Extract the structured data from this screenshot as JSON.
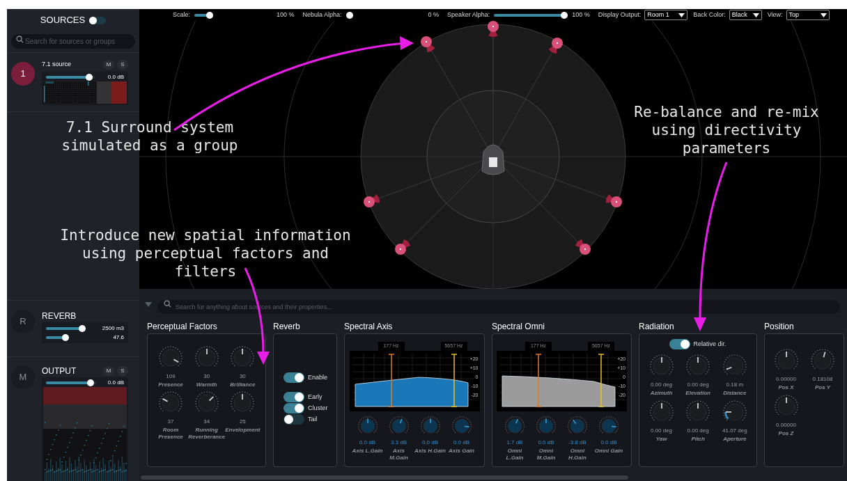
{
  "sidebar": {
    "title": "SOURCES",
    "toggle_on": false,
    "search": {
      "placeholder": "Search for sources or groups"
    },
    "sources": [
      {
        "badge": "1",
        "name": "7.1 source",
        "mute": "M",
        "solo": "S",
        "level": 0.95,
        "reading": "0.0 dB"
      }
    ],
    "reverb": {
      "badge": "R",
      "title": "REVERB",
      "sliders": [
        {
          "level": 0.9,
          "reading": "2500 m3"
        },
        {
          "level": 0.45,
          "reading": "47.6"
        }
      ]
    },
    "output": {
      "badge": "M",
      "title": "OUTPUT",
      "mute": "M",
      "solo": "S",
      "level": 0.95,
      "reading": "0.0 dB"
    }
  },
  "toolbar": {
    "sliders": [
      {
        "label": "Scale:",
        "level": 0.17,
        "reading": "100 %"
      },
      {
        "label": "Nebula Alpha:",
        "level": 0,
        "reading": "0 %"
      },
      {
        "label": "Speaker Alpha:",
        "level": 1,
        "reading": "100 %"
      }
    ],
    "selects": [
      {
        "label": "Display Output:",
        "value": "Room 1"
      },
      {
        "label": "Back Color:",
        "value": "Black"
      },
      {
        "label": "View:",
        "value": "Top"
      }
    ]
  },
  "annotations": [
    {
      "text": "7.1 Surround system\nsimulated as a group"
    },
    {
      "text": "Introduce new spatial information\nusing perceptual factors and\nfilters"
    },
    {
      "text": "Re-balance and re-mix\nusing directivity\nparameters"
    }
  ],
  "properties": {
    "search": {
      "placeholder": "Search for anything about sources and their properties..."
    },
    "perceptual": {
      "title": "Perceptual Factors",
      "knobs": [
        {
          "value": "109",
          "label": "Presence",
          "level": 0.94
        },
        {
          "value": "30",
          "label": "Warmth",
          "level": 0.5
        },
        {
          "value": "30",
          "label": "Brilliance",
          "level": 0.5
        },
        {
          "value": "37",
          "label": "Room Presence",
          "level": 0.27
        },
        {
          "value": "34",
          "label": "Running Reverberance",
          "level": 0.67
        },
        {
          "value": "25",
          "label": "Envelopment",
          "level": 0.5
        }
      ]
    },
    "reverb": {
      "title": "Reverb",
      "toggles": [
        {
          "label": "Enable",
          "on": true
        },
        {
          "label": "Early",
          "on": true
        },
        {
          "label": "Cluster",
          "on": true
        },
        {
          "label": "Tail",
          "on": false
        }
      ]
    },
    "spectral": [
      {
        "title": "Spectral Axis",
        "color": "#1a78b8",
        "markers": [
          "177 Hz",
          "5657 Hz"
        ],
        "ticks": [
          "+20",
          "+10",
          "0",
          "-10",
          "-20"
        ],
        "knobs": [
          {
            "value": "0.0 dB",
            "label": "Axis L.Gain",
            "level": 0.5
          },
          {
            "value": "3.3 dB",
            "label": "Axis M.Gain",
            "level": 0.58
          },
          {
            "value": "0.0 dB",
            "label": "Axis H.Gain",
            "level": 0.5
          },
          {
            "value": "0.0 dB",
            "label": "Axis Gain",
            "level": 0.86
          }
        ]
      },
      {
        "title": "Spectral Omni",
        "color": "#9b9b9b",
        "markers": [
          "177 Hz",
          "5657 Hz"
        ],
        "ticks": [
          "+20",
          "+10",
          "0",
          "-10",
          "-20"
        ],
        "knobs": [
          {
            "value": "1.7 dB",
            "label": "Omni L.Gain",
            "level": 0.59
          },
          {
            "value": "0.0 dB",
            "label": "Omni M.Gain",
            "level": 0.5
          },
          {
            "value": "-3.8 dB",
            "label": "Omni H.Gain",
            "level": 0.37
          },
          {
            "value": "0.0 dB",
            "label": "Omni Gain",
            "level": 0.86
          }
        ]
      }
    ],
    "radiation": {
      "title": "Radiation",
      "toggle": {
        "label": "Relative dir.",
        "on": true
      },
      "knobs": [
        {
          "value": "0.00 deg",
          "label": "Azimuth",
          "level": 0.5
        },
        {
          "value": "0.00 deg",
          "label": "Elevation",
          "level": 0.5
        },
        {
          "value": "0.18 m",
          "label": "Distance",
          "level": 0.09
        },
        {
          "value": "0.00 deg",
          "label": "Yaw",
          "level": 0.5
        },
        {
          "value": "0.00 deg",
          "label": "Pitch",
          "level": 0.5
        },
        {
          "value": "41.07 deg",
          "label": "Aperture",
          "level": 0.17
        }
      ]
    },
    "position": {
      "title": "Position",
      "knobs": [
        {
          "value": "0.00000",
          "label": "Pos X",
          "level": 0.5
        },
        {
          "value": "0.18108",
          "label": "Pos Y",
          "level": 0.56
        },
        {
          "value": "0.00000",
          "label": "Pos Z",
          "level": 0.5
        }
      ]
    }
  }
}
